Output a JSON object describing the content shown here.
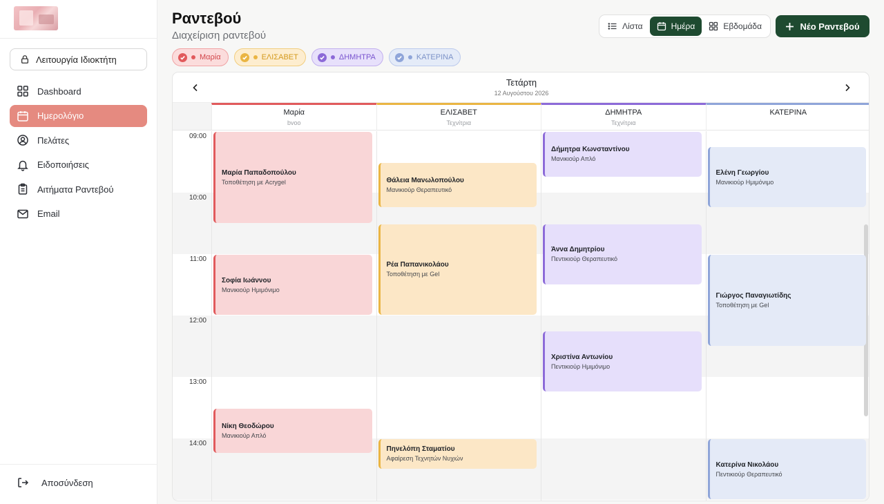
{
  "sidebar": {
    "owner_mode_label": "Λειτουργία Ιδιοκτήτη",
    "items": [
      {
        "label": "Dashboard",
        "icon": "dashboard-icon",
        "active": false
      },
      {
        "label": "Ημερολόγιο",
        "icon": "calendar-icon",
        "active": true
      },
      {
        "label": "Πελάτες",
        "icon": "user-circle-icon",
        "active": false
      },
      {
        "label": "Ειδοποιήσεις",
        "icon": "bell-icon",
        "active": false
      },
      {
        "label": "Αιτήματα Ραντεβού",
        "icon": "clipboard-icon",
        "active": false
      },
      {
        "label": "Email",
        "icon": "mail-icon",
        "active": false
      }
    ],
    "logout_label": "Αποσύνδεση"
  },
  "header": {
    "title": "Ραντεβού",
    "subtitle": "Διαχείριση ραντεβού",
    "views": {
      "list": "Λίστα",
      "day": "Ημέρα",
      "week": "Εβδομάδα",
      "active": "day"
    },
    "new_button": "Νέο Ραντεβού"
  },
  "filters": [
    {
      "label": "Μαρία",
      "color": "#e15a5c",
      "bg": "#fbdcdc",
      "border": "#f0a3a4",
      "text": "#d2464a"
    },
    {
      "label": "ΕΛΙΣΑΒΕΤ",
      "color": "#eab543",
      "bg": "#fdedcf",
      "border": "#f1cd7f",
      "text": "#d49a1e"
    },
    {
      "label": "ΔΗΜΗΤΡΑ",
      "color": "#8c6ad8",
      "bg": "#e7e0fb",
      "border": "#c2b0ee",
      "text": "#7a55cf"
    },
    {
      "label": "ΚΑΤΕΡΙΝΑ",
      "color": "#8fa5d9",
      "bg": "#e4ebf8",
      "border": "#bccaec",
      "text": "#7d93c8"
    }
  ],
  "calendar": {
    "day_name": "Τετάρτη",
    "date": "12 Αυγούστου 2026",
    "columns": [
      {
        "name": "Μαρία",
        "role": "bvoo",
        "color": "#e15a5c"
      },
      {
        "name": "ΕΛΙΣΑΒΕΤ",
        "role": "Τεχνίτρια",
        "color": "#eab543"
      },
      {
        "name": "ΔΗΜΗΤΡΑ",
        "role": "Τεχνίτρια",
        "color": "#8c6ad8"
      },
      {
        "name": "ΚΑΤΕΡΙΝΑ",
        "role": "",
        "color": "#8fa5d9"
      }
    ],
    "times": [
      "09:00",
      "10:00",
      "11:00",
      "12:00",
      "13:00",
      "14:00"
    ],
    "events": [
      {
        "col": 0,
        "start": "09:00",
        "end": "10:30",
        "client": "Μαρία Παπαδοπούλου",
        "service": "Τοποθέτηση με Acrygel",
        "theme": "red"
      },
      {
        "col": 0,
        "start": "11:00",
        "end": "12:00",
        "client": "Σοφία Ιωάννου",
        "service": "Μανικιούρ Ημιμόνιμο",
        "theme": "red"
      },
      {
        "col": 0,
        "start": "13:30",
        "end": "14:15",
        "client": "Νίκη Θεοδώρου",
        "service": "Μανικιούρ Απλό",
        "theme": "red"
      },
      {
        "col": 1,
        "start": "09:30",
        "end": "10:15",
        "client": "Θάλεια Μανωλοπούλου",
        "service": "Μανικιούρ Θεραπευτικό",
        "theme": "amber"
      },
      {
        "col": 1,
        "start": "10:30",
        "end": "12:00",
        "client": "Ρέα Παπανικολάου",
        "service": "Τοποθέτηση με Gel",
        "theme": "amber"
      },
      {
        "col": 1,
        "start": "14:00",
        "end": "14:30",
        "client": "Πηνελόπη Σταματίου",
        "service": "Αφαίρεση Τεχνητών Νυχιών",
        "theme": "amber"
      },
      {
        "col": 2,
        "start": "09:00",
        "end": "09:45",
        "client": "Δήμητρα Κωνσταντίνου",
        "service": "Μανικιούρ Απλό",
        "theme": "purple"
      },
      {
        "col": 2,
        "start": "10:30",
        "end": "11:30",
        "client": "Άννα Δημητρίου",
        "service": "Πεντικιούρ Θεραπευτικό",
        "theme": "purple"
      },
      {
        "col": 2,
        "start": "12:15",
        "end": "13:15",
        "client": "Χριστίνα Αντωνίου",
        "service": "Πεντικιούρ Ημιμόνιμο",
        "theme": "purple"
      },
      {
        "col": 3,
        "start": "09:15",
        "end": "10:15",
        "client": "Ελένη Γεωργίου",
        "service": "Μανικιούρ Ημιμόνιμο",
        "theme": "blue"
      },
      {
        "col": 3,
        "start": "11:00",
        "end": "12:30",
        "client": "Γιώργος Παναγιωτίδης",
        "service": "Τοποθέτηση με Gel",
        "theme": "blue"
      },
      {
        "col": 3,
        "start": "14:00",
        "end": "15:00",
        "client": "Κατερίνα Νικολάου",
        "service": "Πεντικιούρ Θεραπευτικό",
        "theme": "blue"
      }
    ]
  }
}
